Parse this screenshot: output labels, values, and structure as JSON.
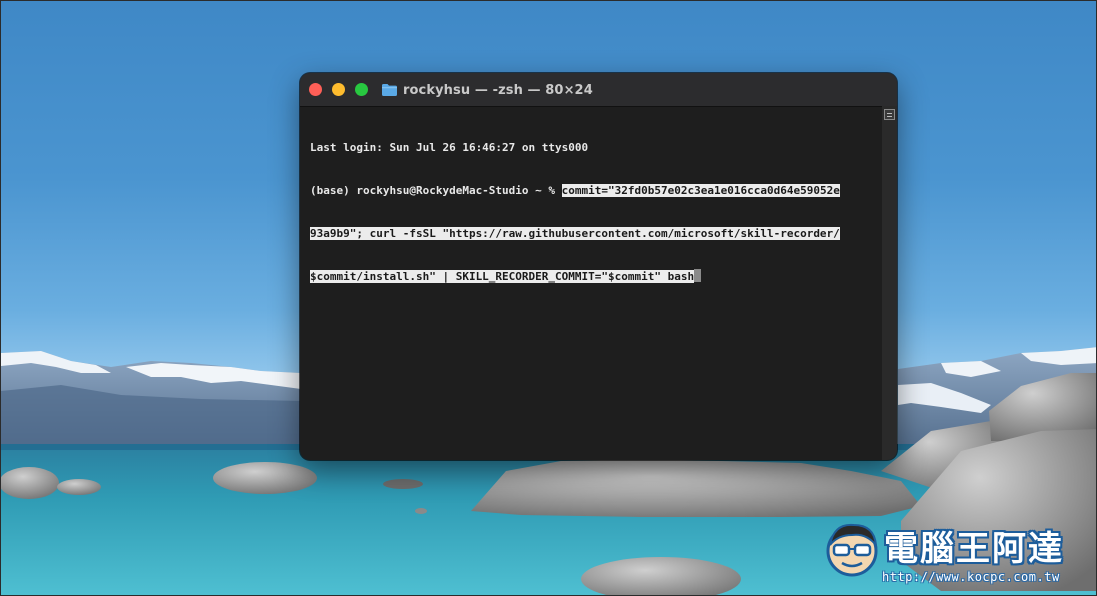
{
  "window": {
    "title": "rockyhsu — -zsh — 80×24",
    "icon": "folder-icon"
  },
  "terminal": {
    "lines": [
      {
        "plain": "Last login: Sun Jul 26 16:46:27 on ttys000",
        "selected": ""
      },
      {
        "plain": "(base) rockyhsu@RockydeMac-Studio ~ % ",
        "selected": "commit=\"32fd0b57e02c3ea1e016cca0d64e59052e"
      },
      {
        "plain": "",
        "selected": "93a9b9\"; curl -fsSL \"https://raw.githubusercontent.com/microsoft/skill-recorder/"
      },
      {
        "plain": "",
        "selected": "$commit/install.sh\" | SKILL_RECORDER_COMMIT=\"$commit\" bash"
      }
    ]
  },
  "watermark": {
    "title": "電腦王阿達",
    "url": "http://www.kocpc.com.tw"
  },
  "colors": {
    "close": "#fe5f57",
    "minimize": "#febc2e",
    "maximize": "#28c840",
    "terminal_bg": "#1e1e1e",
    "titlebar_bg": "#2c2c2e",
    "selection_bg": "#ececec"
  }
}
